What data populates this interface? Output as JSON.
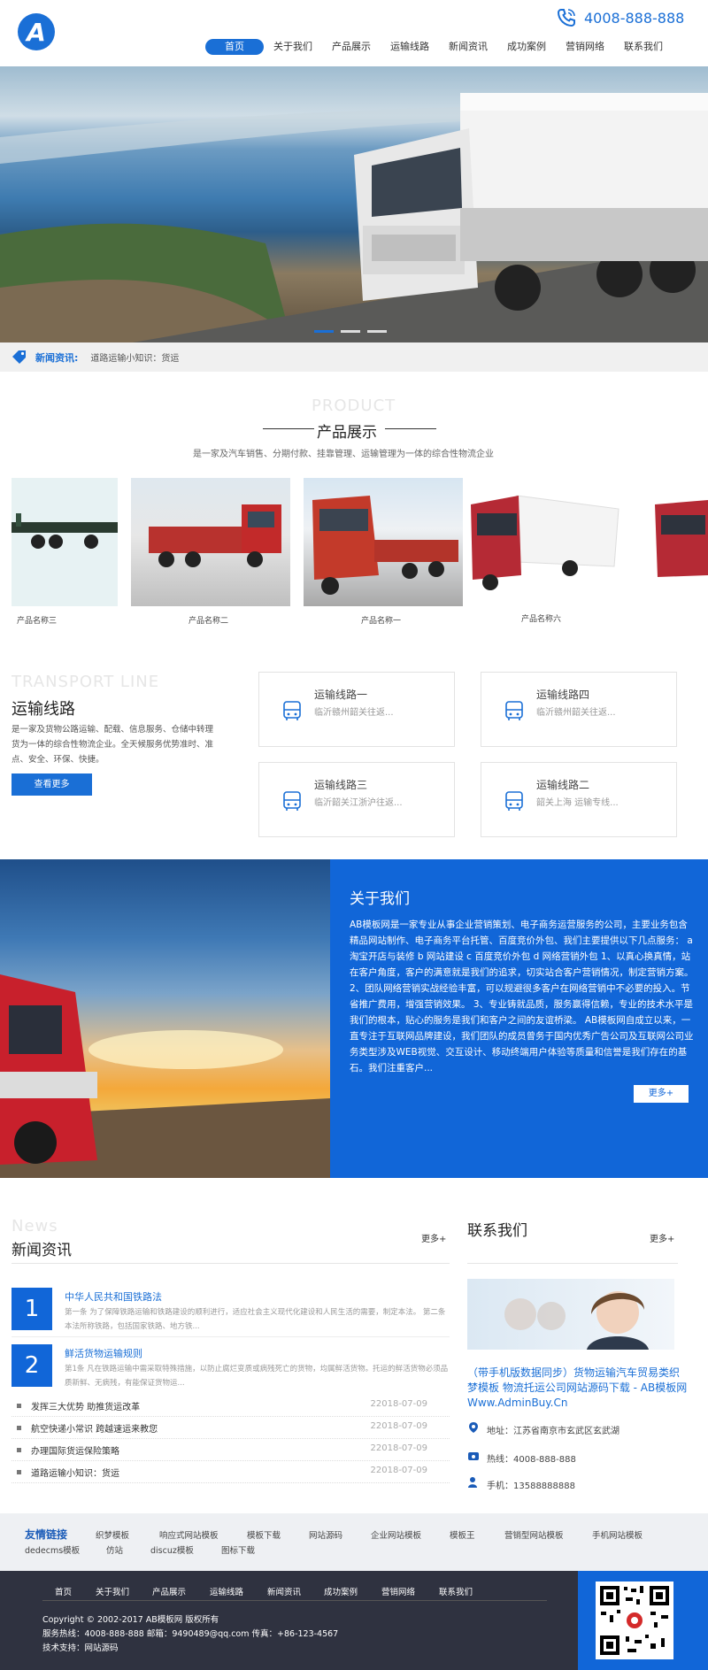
{
  "header": {
    "phone": "4008-888-888",
    "nav": [
      {
        "label": "首页",
        "active": true
      },
      {
        "label": "关于我们"
      },
      {
        "label": "产品展示"
      },
      {
        "label": "运输线路"
      },
      {
        "label": "新闻资讯"
      },
      {
        "label": "成功案例"
      },
      {
        "label": "营销网络"
      },
      {
        "label": "联系我们"
      }
    ]
  },
  "ticker": {
    "label": "新闻资讯:",
    "text": "道路运输小知识：货运"
  },
  "products": {
    "en": "PRODUCT",
    "title": "产品展示",
    "subtitle": "是一家及汽车销售、分期付款、挂靠管理、运输管理为一体的综合性物流企业",
    "items": [
      {
        "name": "产品名称三"
      },
      {
        "name": "产品名称二"
      },
      {
        "name": "产品名称一"
      },
      {
        "name": "产品名称六"
      }
    ]
  },
  "routes": {
    "en": "TRANSPORT LINE",
    "title": "运输线路",
    "desc": "是一家及货物公路运输、配载、信息服务、仓储中转理货为一体的综合性物流企业。全天候服务优势准时、准点、安全、环保、快捷。",
    "more": "查看更多",
    "items": [
      {
        "title": "运输线路一",
        "desc": "临沂赣州韶关往返..."
      },
      {
        "title": "运输线路四",
        "desc": "临沂赣州韶关往返..."
      },
      {
        "title": "运输线路三",
        "desc": "临沂韶关江浙沪往返..."
      },
      {
        "title": "运输线路二",
        "desc": "韶关上海 运输专线..."
      }
    ]
  },
  "about": {
    "title": "关于我们",
    "text": "AB模板网是一家专业从事企业营销策划、电子商务运营服务的公司，主要业务包含精品网站制作、电子商务平台托管、百度竞价外包、我们主要提供以下几点服务： a 淘宝开店与装修 b 网站建设 c 百度竞价外包 d 网络营销外包 1、以真心换真情，站在客户角度，客户的满意就是我们的追求，切实站合客户营销情况，制定营销方案。 2、团队网络营销实战经验丰富，可以规避很多客户在网络营销中不必要的投入。节省推广费用，增强营销效果。 3、专业铸就品质，服务赢得信赖，专业的技术水平是我们的根本，贴心的服务是我们和客户之间的友谊桥梁。 AB模板网自成立以来，一直专注于互联网品牌建设，我们团队的成员曾务于国内优秀广告公司及互联网公司业务类型涉及WEB视觉、交互设计、移动终端用户体验等质量和信誉是我们存在的基石。我们注重客户...",
    "more": "更多+"
  },
  "news": {
    "en": "News",
    "title": "新闻资讯",
    "more": "更多+",
    "featured": [
      {
        "num": "1",
        "title": "中华人民共和国铁路法",
        "desc": "第一条 为了保障铁路运输和铁路建设的顺利进行，适应社会主义现代化建设和人民生活的需要，制定本法。 第二条 本法所称铁路，包括国家铁路、地方铁..."
      },
      {
        "num": "2",
        "title": "鲜活货物运输规则",
        "desc": "第1条 凡在铁路运输中需采取特殊措施，以防止腐烂变质或病残死亡的货物，均属鲜活货物。托运的鲜活货物必须品质新鲜、无病残，有能保证货物运..."
      }
    ],
    "list": [
      {
        "title": "发挥三大优势 助推货运改革",
        "date": "22018-07-09"
      },
      {
        "title": "航空快递小常识 跨越速运来教您",
        "date": "22018-07-09"
      },
      {
        "title": "办理国际货运保险策略",
        "date": "22018-07-09"
      },
      {
        "title": "道路运输小知识：货运",
        "date": "22018-07-09"
      }
    ]
  },
  "contact": {
    "title": "联系我们",
    "more": "更多+",
    "headline": "（带手机版数据同步）货物运输汽车贸易类织梦模板 物流托运公司网站源码下载 - AB模板网 Www.AdminBuy.Cn",
    "address": "地址：江苏省南京市玄武区玄武湖",
    "hotline": "热线：4008-888-888",
    "mobile": "手机：13588888888"
  },
  "friend_links": {
    "title": "友情链接",
    "items": [
      "织梦模板",
      "响应式网站模板",
      "模板下载",
      "网站源码",
      "企业网站模板",
      "模板王",
      "营销型网站模板",
      "手机网站模板",
      "dedecms模板",
      "仿站",
      "discuz模板",
      "图标下载"
    ]
  },
  "footer": {
    "nav": [
      "首页",
      "关于我们",
      "产品展示",
      "运输线路",
      "新闻资讯",
      "成功案例",
      "营销网络",
      "联系我们"
    ],
    "copyright": "Copyright © 2002-2017 AB模板网 版权所有",
    "service": "服务热线：4008-888-888 邮箱：9490489@qq.com 传真：+86-123-4567",
    "support": "技术支持：网站源码"
  },
  "colors": {
    "accent": "#1166d8"
  }
}
